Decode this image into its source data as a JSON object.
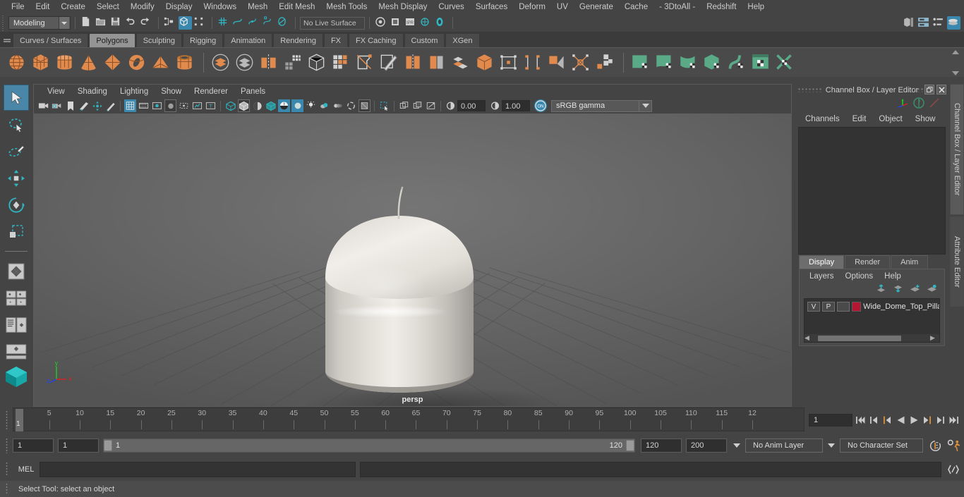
{
  "menubar": {
    "items": [
      "File",
      "Edit",
      "Create",
      "Select",
      "Modify",
      "Display",
      "Windows",
      "Mesh",
      "Edit Mesh",
      "Mesh Tools",
      "Mesh Display",
      "Curves",
      "Surfaces",
      "Deform",
      "UV",
      "Generate",
      "Cache",
      "- 3DtoAll -",
      "Redshift",
      "Help"
    ]
  },
  "statusline": {
    "menuset": "Modeling",
    "live_surface": "No Live Surface",
    "icons": [
      "new-scene-icon",
      "open-scene-icon",
      "save-scene-icon",
      "undo-icon",
      "redo-icon",
      "select-by-hierarchy-icon",
      "select-by-object-icon",
      "select-by-component-icon",
      "snap-to-grid-icon",
      "snap-to-curve-icon",
      "snap-to-point-icon",
      "snap-to-projected-center-icon",
      "snap-to-view-plane-icon",
      "render-current-frame-icon",
      "ipr-render-icon",
      "render-settings-icon",
      "hypershade-icon",
      "render-view-icon"
    ],
    "right_icons": [
      "show-hide-modeling-toolkit-icon",
      "show-hide-attribute-editor-icon",
      "show-hide-tool-settings-icon",
      "show-hide-channel-box-icon"
    ]
  },
  "shelf": {
    "tabs": [
      "Curves / Surfaces",
      "Polygons",
      "Sculpting",
      "Rigging",
      "Animation",
      "Rendering",
      "FX",
      "FX Caching",
      "Custom",
      "XGen"
    ],
    "selected_tab": "Polygons",
    "group1": [
      "poly-sphere-icon",
      "poly-cube-icon",
      "poly-cylinder-icon",
      "poly-cone-icon",
      "poly-octahedron-icon",
      "poly-torus-icon",
      "poly-pyramid-icon",
      "poly-pipe-icon"
    ],
    "group2": [
      "combine-icon",
      "separate-icon",
      "mirror-icon",
      "smooth-icon",
      "boolean-icon",
      "extrude-icon",
      "bevel-icon",
      "multi-cut-icon",
      "target-weld-icon",
      "quad-draw-icon",
      "insert-edge-loop-icon",
      "offset-edge-loop-icon",
      "connect-icon",
      "merge-icon",
      "poly-append-icon",
      "sculpt-icon",
      "crease-icon"
    ],
    "group3": [
      "uv-editor-icon",
      "planar-map-icon",
      "cylindrical-map-icon",
      "automatic-map-icon",
      "unfold-icon",
      "uv-snapshot-icon",
      "uv-cut-sew-icon"
    ]
  },
  "toolbox": {
    "items": [
      "select-tool",
      "lasso-select-tool",
      "paint-select-tool",
      "move-tool",
      "rotate-tool",
      "scale-tool",
      "last-tool-used",
      "snap-grid-tool",
      "snap-curve-tool",
      "snap-point-tool",
      "snap-view-tool",
      "show-manipulator-tool",
      "outliner-layout-icon",
      "persp-layout-icon",
      "single-perspective-view-icon",
      "maya-logo-icon"
    ],
    "selected": "select-tool"
  },
  "viewport": {
    "menus": [
      "View",
      "Shading",
      "Lighting",
      "Show",
      "Renderer",
      "Panels"
    ],
    "camera_label": "persp",
    "exposure_value": "0.00",
    "gamma_value": "1.00",
    "color_management": "sRGB gamma",
    "toolbar_icons": [
      "select-camera-icon",
      "camera-attributes-icon",
      "bookmark-icon",
      "image-plane-icon",
      "two-d-pan-zoom-icon",
      "grease-pencil-icon",
      "grid-toggle-icon",
      "film-gate-icon",
      "resolution-gate-icon",
      "gate-mask-icon",
      "film-origin-icon",
      "safe-action-icon",
      "safe-title-icon",
      "wireframe-icon",
      "smooth-shade-all-icon",
      "flat-shade-icon",
      "shaded-wireframe-icon",
      "texture-mode-icon",
      "use-all-lights-icon",
      "shadows-icon",
      "screen-space-ao-icon",
      "motion-blur-icon",
      "multisample-icon",
      "depth-peeling-icon",
      "xray-mode-icon",
      "isolate-select-icon",
      "grid-display-icon",
      "film-gate-display-icon",
      "panel-zoom-icon",
      "exposure-icon",
      "gamma-icon",
      "color-management-toggle-icon"
    ],
    "axis_labels": {
      "x": "x",
      "y": "y",
      "z": "z"
    },
    "scene_object": "pillar-candle-model"
  },
  "right_dock": {
    "title": "Channel Box / Layer Editor",
    "channel_menus": [
      "Channels",
      "Edit",
      "Object",
      "Show"
    ],
    "header_icons": [
      "transform-channels-icon",
      "output-channels-icon",
      "shape-channels-icon"
    ],
    "window_buttons": [
      "undock-icon",
      "close-icon"
    ],
    "layer_tabs": [
      "Display",
      "Render",
      "Anim"
    ],
    "selected_layer_tab": "Display",
    "layer_menus": [
      "Layers",
      "Options",
      "Help"
    ],
    "layer_buttons": [
      "move-layer-up-icon",
      "move-layer-down-icon",
      "new-layer-icon",
      "new-layer-from-selected-icon"
    ],
    "layers": [
      {
        "visibility": "V",
        "playback": "P",
        "shading": "",
        "color": "#b51632",
        "name": "Wide_Dome_Top_Pillar"
      }
    ],
    "vertical_tabs": [
      "Channel Box / Layer Editor",
      "Attribute Editor"
    ]
  },
  "timeline": {
    "start": 1,
    "end": 120,
    "current_frame": "1",
    "tick_labels": [
      "5",
      "10",
      "15",
      "20",
      "25",
      "30",
      "35",
      "40",
      "45",
      "50",
      "55",
      "60",
      "65",
      "70",
      "75",
      "80",
      "85",
      "90",
      "95",
      "100",
      "105",
      "110",
      "115",
      "12"
    ],
    "playback_buttons": [
      "go-to-start-icon",
      "step-back-frame-icon",
      "step-back-key-icon",
      "play-backwards-icon",
      "play-forwards-icon",
      "step-forward-key-icon",
      "step-forward-frame-icon",
      "go-to-end-icon"
    ]
  },
  "range_row": {
    "anim_start": "1",
    "playback_start": "1",
    "slider_min_label": "1",
    "slider_max_label": "120",
    "playback_end": "120",
    "anim_end": "200",
    "anim_layer": "No Anim Layer",
    "character_set": "No Character Set",
    "right_icons": [
      "auto-key-icon",
      "animation-preferences-icon"
    ]
  },
  "command_line": {
    "label": "MEL",
    "input_value": "",
    "output_value": "",
    "script-editor-icon": "script-editor-icon"
  },
  "help_line": {
    "text": "Select Tool: select an object"
  },
  "colors": {
    "accent_blue": "#3a88ad",
    "shelf_orange": "#e08a4d",
    "uv_green": "#5aa987",
    "layer_red": "#b51632",
    "panel_bg": "#444444"
  }
}
